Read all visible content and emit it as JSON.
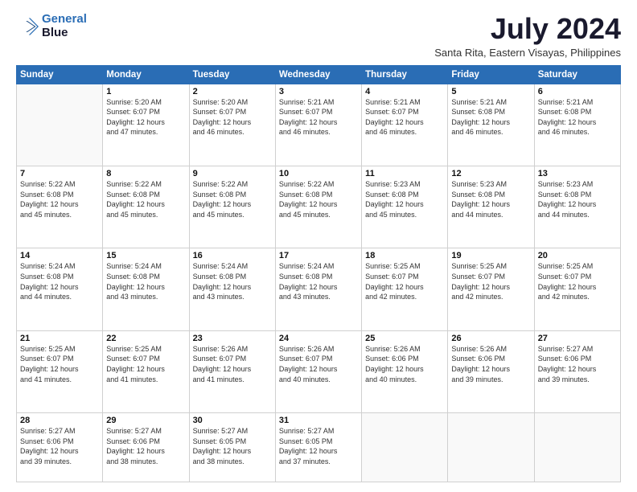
{
  "logo": {
    "line1": "General",
    "line2": "Blue"
  },
  "title": "July 2024",
  "location": "Santa Rita, Eastern Visayas, Philippines",
  "days_of_week": [
    "Sunday",
    "Monday",
    "Tuesday",
    "Wednesday",
    "Thursday",
    "Friday",
    "Saturday"
  ],
  "weeks": [
    [
      {
        "day": "",
        "text": ""
      },
      {
        "day": "1",
        "text": "Sunrise: 5:20 AM\nSunset: 6:07 PM\nDaylight: 12 hours\nand 47 minutes."
      },
      {
        "day": "2",
        "text": "Sunrise: 5:20 AM\nSunset: 6:07 PM\nDaylight: 12 hours\nand 46 minutes."
      },
      {
        "day": "3",
        "text": "Sunrise: 5:21 AM\nSunset: 6:07 PM\nDaylight: 12 hours\nand 46 minutes."
      },
      {
        "day": "4",
        "text": "Sunrise: 5:21 AM\nSunset: 6:07 PM\nDaylight: 12 hours\nand 46 minutes."
      },
      {
        "day": "5",
        "text": "Sunrise: 5:21 AM\nSunset: 6:08 PM\nDaylight: 12 hours\nand 46 minutes."
      },
      {
        "day": "6",
        "text": "Sunrise: 5:21 AM\nSunset: 6:08 PM\nDaylight: 12 hours\nand 46 minutes."
      }
    ],
    [
      {
        "day": "7",
        "text": "Sunrise: 5:22 AM\nSunset: 6:08 PM\nDaylight: 12 hours\nand 45 minutes."
      },
      {
        "day": "8",
        "text": "Sunrise: 5:22 AM\nSunset: 6:08 PM\nDaylight: 12 hours\nand 45 minutes."
      },
      {
        "day": "9",
        "text": "Sunrise: 5:22 AM\nSunset: 6:08 PM\nDaylight: 12 hours\nand 45 minutes."
      },
      {
        "day": "10",
        "text": "Sunrise: 5:22 AM\nSunset: 6:08 PM\nDaylight: 12 hours\nand 45 minutes."
      },
      {
        "day": "11",
        "text": "Sunrise: 5:23 AM\nSunset: 6:08 PM\nDaylight: 12 hours\nand 45 minutes."
      },
      {
        "day": "12",
        "text": "Sunrise: 5:23 AM\nSunset: 6:08 PM\nDaylight: 12 hours\nand 44 minutes."
      },
      {
        "day": "13",
        "text": "Sunrise: 5:23 AM\nSunset: 6:08 PM\nDaylight: 12 hours\nand 44 minutes."
      }
    ],
    [
      {
        "day": "14",
        "text": "Sunrise: 5:24 AM\nSunset: 6:08 PM\nDaylight: 12 hours\nand 44 minutes."
      },
      {
        "day": "15",
        "text": "Sunrise: 5:24 AM\nSunset: 6:08 PM\nDaylight: 12 hours\nand 43 minutes."
      },
      {
        "day": "16",
        "text": "Sunrise: 5:24 AM\nSunset: 6:08 PM\nDaylight: 12 hours\nand 43 minutes."
      },
      {
        "day": "17",
        "text": "Sunrise: 5:24 AM\nSunset: 6:08 PM\nDaylight: 12 hours\nand 43 minutes."
      },
      {
        "day": "18",
        "text": "Sunrise: 5:25 AM\nSunset: 6:07 PM\nDaylight: 12 hours\nand 42 minutes."
      },
      {
        "day": "19",
        "text": "Sunrise: 5:25 AM\nSunset: 6:07 PM\nDaylight: 12 hours\nand 42 minutes."
      },
      {
        "day": "20",
        "text": "Sunrise: 5:25 AM\nSunset: 6:07 PM\nDaylight: 12 hours\nand 42 minutes."
      }
    ],
    [
      {
        "day": "21",
        "text": "Sunrise: 5:25 AM\nSunset: 6:07 PM\nDaylight: 12 hours\nand 41 minutes."
      },
      {
        "day": "22",
        "text": "Sunrise: 5:25 AM\nSunset: 6:07 PM\nDaylight: 12 hours\nand 41 minutes."
      },
      {
        "day": "23",
        "text": "Sunrise: 5:26 AM\nSunset: 6:07 PM\nDaylight: 12 hours\nand 41 minutes."
      },
      {
        "day": "24",
        "text": "Sunrise: 5:26 AM\nSunset: 6:07 PM\nDaylight: 12 hours\nand 40 minutes."
      },
      {
        "day": "25",
        "text": "Sunrise: 5:26 AM\nSunset: 6:06 PM\nDaylight: 12 hours\nand 40 minutes."
      },
      {
        "day": "26",
        "text": "Sunrise: 5:26 AM\nSunset: 6:06 PM\nDaylight: 12 hours\nand 39 minutes."
      },
      {
        "day": "27",
        "text": "Sunrise: 5:27 AM\nSunset: 6:06 PM\nDaylight: 12 hours\nand 39 minutes."
      }
    ],
    [
      {
        "day": "28",
        "text": "Sunrise: 5:27 AM\nSunset: 6:06 PM\nDaylight: 12 hours\nand 39 minutes."
      },
      {
        "day": "29",
        "text": "Sunrise: 5:27 AM\nSunset: 6:06 PM\nDaylight: 12 hours\nand 38 minutes."
      },
      {
        "day": "30",
        "text": "Sunrise: 5:27 AM\nSunset: 6:05 PM\nDaylight: 12 hours\nand 38 minutes."
      },
      {
        "day": "31",
        "text": "Sunrise: 5:27 AM\nSunset: 6:05 PM\nDaylight: 12 hours\nand 37 minutes."
      },
      {
        "day": "",
        "text": ""
      },
      {
        "day": "",
        "text": ""
      },
      {
        "day": "",
        "text": ""
      }
    ]
  ]
}
